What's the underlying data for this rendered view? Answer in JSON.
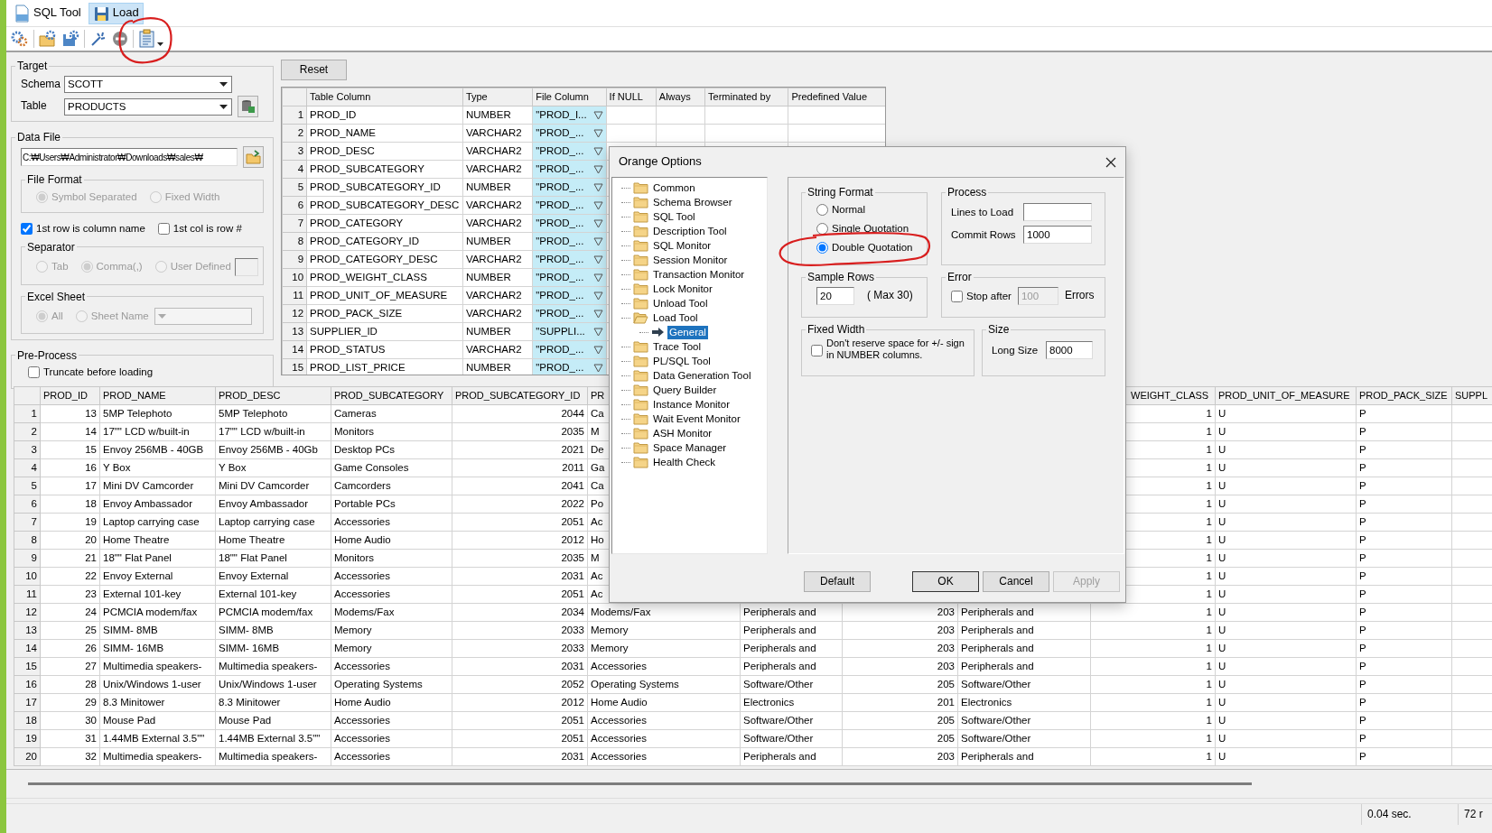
{
  "tabs": [
    {
      "label": "SQL Tool",
      "selected": false
    },
    {
      "label": "Load",
      "selected": true
    }
  ],
  "target": {
    "title": "Target",
    "schema_label": "Schema",
    "schema": "SCOTT",
    "table_label": "Table",
    "table": "PRODUCTS"
  },
  "data_file": {
    "title": "Data File",
    "path": "C:₩Users₩Administrator₩Downloads₩sales₩",
    "file_format": {
      "title": "File Format",
      "disabled": true,
      "options": [
        {
          "label": "Symbol Separated",
          "selected": true
        },
        {
          "label": "Fixed Width",
          "selected": false
        }
      ]
    },
    "checks": [
      {
        "label": "1st row is column name",
        "checked": true
      },
      {
        "label": "1st col is row #",
        "checked": false
      }
    ],
    "separator": {
      "title": "Separator",
      "disabled": true,
      "options": [
        {
          "label": "Tab",
          "selected": false
        },
        {
          "label": "Comma(,)",
          "selected": true
        },
        {
          "label": "User Defined",
          "selected": false
        }
      ]
    },
    "excel_sheet": {
      "title": "Excel Sheet",
      "disabled": true,
      "options": [
        {
          "label": "All",
          "selected": true
        },
        {
          "label": "Sheet Name",
          "selected": false
        }
      ]
    }
  },
  "pre_process": {
    "title": "Pre-Process",
    "checks": [
      {
        "label": "Truncate before loading",
        "checked": false
      }
    ]
  },
  "reset_button": "Reset",
  "mapping": {
    "columns": [
      "Table Column",
      "Type",
      "File Column",
      "If NULL",
      "Always",
      "Terminated by",
      "Predefined Value"
    ],
    "rows": [
      {
        "n": "1",
        "table_column": "PROD_ID",
        "type": "NUMBER",
        "file_column": "\"PROD_I..."
      },
      {
        "n": "2",
        "table_column": "PROD_NAME",
        "type": "VARCHAR2",
        "file_column": "\"PROD_..."
      },
      {
        "n": "3",
        "table_column": "PROD_DESC",
        "type": "VARCHAR2",
        "file_column": "\"PROD_..."
      },
      {
        "n": "4",
        "table_column": "PROD_SUBCATEGORY",
        "type": "VARCHAR2",
        "file_column": "\"PROD_..."
      },
      {
        "n": "5",
        "table_column": "PROD_SUBCATEGORY_ID",
        "type": "NUMBER",
        "file_column": "\"PROD_..."
      },
      {
        "n": "6",
        "table_column": "PROD_SUBCATEGORY_DESC",
        "type": "VARCHAR2",
        "file_column": "\"PROD_..."
      },
      {
        "n": "7",
        "table_column": "PROD_CATEGORY",
        "type": "VARCHAR2",
        "file_column": "\"PROD_..."
      },
      {
        "n": "8",
        "table_column": "PROD_CATEGORY_ID",
        "type": "NUMBER",
        "file_column": "\"PROD_..."
      },
      {
        "n": "9",
        "table_column": "PROD_CATEGORY_DESC",
        "type": "VARCHAR2",
        "file_column": "\"PROD_..."
      },
      {
        "n": "10",
        "table_column": "PROD_WEIGHT_CLASS",
        "type": "NUMBER",
        "file_column": "\"PROD_..."
      },
      {
        "n": "11",
        "table_column": "PROD_UNIT_OF_MEASURE",
        "type": "VARCHAR2",
        "file_column": "\"PROD_..."
      },
      {
        "n": "12",
        "table_column": "PROD_PACK_SIZE",
        "type": "VARCHAR2",
        "file_column": "\"PROD_..."
      },
      {
        "n": "13",
        "table_column": "SUPPLIER_ID",
        "type": "NUMBER",
        "file_column": "\"SUPPLI..."
      },
      {
        "n": "14",
        "table_column": "PROD_STATUS",
        "type": "VARCHAR2",
        "file_column": "\"PROD_..."
      },
      {
        "n": "15",
        "table_column": "PROD_LIST_PRICE",
        "type": "NUMBER",
        "file_column": "\"PROD_..."
      }
    ]
  },
  "grid": {
    "columns": [
      "PROD_ID",
      "PROD_NAME",
      "PROD_DESC",
      "PROD_SUBCATEGORY",
      "PROD_SUBCATEGORY_ID",
      "PR",
      null,
      null,
      null,
      "WEIGHT_CLASS",
      "PROD_UNIT_OF_MEASURE",
      "PROD_PACK_SIZE",
      "SUPPL"
    ],
    "rows": [
      {
        "n": "1",
        "cells": [
          "13",
          "5MP Telephoto",
          "5MP Telephoto",
          "Cameras",
          "2044",
          "Ca",
          null,
          null,
          null,
          "1",
          "U",
          "P"
        ]
      },
      {
        "n": "2",
        "cells": [
          "14",
          "17\"\" LCD w/built-in",
          "17\"\" LCD w/built-in",
          "Monitors",
          "2035",
          "M",
          null,
          null,
          null,
          "1",
          "U",
          "P"
        ]
      },
      {
        "n": "3",
        "cells": [
          "15",
          "Envoy 256MB - 40GB",
          "Envoy 256MB - 40Gb",
          "Desktop PCs",
          "2021",
          "De",
          null,
          null,
          null,
          "1",
          "U",
          "P"
        ]
      },
      {
        "n": "4",
        "cells": [
          "16",
          "Y Box",
          "Y Box",
          "Game Consoles",
          "2011",
          "Ga",
          null,
          null,
          null,
          "1",
          "U",
          "P"
        ]
      },
      {
        "n": "5",
        "cells": [
          "17",
          "Mini DV Camcorder",
          "Mini DV Camcorder",
          "Camcorders",
          "2041",
          "Ca",
          null,
          null,
          null,
          "1",
          "U",
          "P"
        ]
      },
      {
        "n": "6",
        "cells": [
          "18",
          "Envoy Ambassador",
          "Envoy Ambassador",
          "Portable PCs",
          "2022",
          "Po",
          null,
          null,
          null,
          "1",
          "U",
          "P"
        ]
      },
      {
        "n": "7",
        "cells": [
          "19",
          "Laptop carrying case",
          "Laptop carrying case",
          "Accessories",
          "2051",
          "Ac",
          null,
          null,
          null,
          "1",
          "U",
          "P"
        ]
      },
      {
        "n": "8",
        "cells": [
          "20",
          "Home Theatre",
          "Home Theatre",
          "Home Audio",
          "2012",
          "Ho",
          null,
          null,
          null,
          "1",
          "U",
          "P"
        ]
      },
      {
        "n": "9",
        "cells": [
          "21",
          "18\"\" Flat Panel",
          "18\"\" Flat Panel",
          "Monitors",
          "2035",
          "M",
          null,
          null,
          null,
          "1",
          "U",
          "P"
        ]
      },
      {
        "n": "10",
        "cells": [
          "22",
          "Envoy External",
          "Envoy External",
          "Accessories",
          "2031",
          "Ac",
          null,
          null,
          null,
          "1",
          "U",
          "P"
        ]
      },
      {
        "n": "11",
        "cells": [
          "23",
          "External 101-key",
          "External 101-key",
          "Accessories",
          "2051",
          "Ac",
          null,
          null,
          null,
          "1",
          "U",
          "P"
        ]
      },
      {
        "n": "12",
        "cells": [
          "24",
          "PCMCIA modem/fax",
          "PCMCIA modem/fax",
          "Modems/Fax",
          "2034",
          "Modems/Fax",
          "Peripherals and",
          "203",
          "Peripherals and",
          "1",
          "U",
          "P"
        ]
      },
      {
        "n": "13",
        "cells": [
          "25",
          "SIMM- 8MB",
          "SIMM- 8MB",
          "Memory",
          "2033",
          "Memory",
          "Peripherals and",
          "203",
          "Peripherals and",
          "1",
          "U",
          "P"
        ]
      },
      {
        "n": "14",
        "cells": [
          "26",
          "SIMM- 16MB",
          "SIMM- 16MB",
          "Memory",
          "2033",
          "Memory",
          "Peripherals and",
          "203",
          "Peripherals and",
          "1",
          "U",
          "P"
        ]
      },
      {
        "n": "15",
        "cells": [
          "27",
          "Multimedia speakers-",
          "Multimedia speakers-",
          "Accessories",
          "2031",
          "Accessories",
          "Peripherals and",
          "203",
          "Peripherals and",
          "1",
          "U",
          "P"
        ]
      },
      {
        "n": "16",
        "cells": [
          "28",
          "Unix/Windows 1-user",
          "Unix/Windows 1-user",
          "Operating Systems",
          "2052",
          "Operating Systems",
          "Software/Other",
          "205",
          "Software/Other",
          "1",
          "U",
          "P"
        ]
      },
      {
        "n": "17",
        "cells": [
          "29",
          "8.3 Minitower",
          "8.3 Minitower",
          "Home Audio",
          "2012",
          "Home Audio",
          "Electronics",
          "201",
          "Electronics",
          "1",
          "U",
          "P"
        ]
      },
      {
        "n": "18",
        "cells": [
          "30",
          "Mouse Pad",
          "Mouse Pad",
          "Accessories",
          "2051",
          "Accessories",
          "Software/Other",
          "205",
          "Software/Other",
          "1",
          "U",
          "P"
        ]
      },
      {
        "n": "19",
        "cells": [
          "31",
          "1.44MB External 3.5\"\"",
          "1.44MB External 3.5\"\"",
          "Accessories",
          "2051",
          "Accessories",
          "Software/Other",
          "205",
          "Software/Other",
          "1",
          "U",
          "P"
        ]
      },
      {
        "n": "20",
        "cells": [
          "32",
          "Multimedia speakers-",
          "Multimedia speakers-",
          "Accessories",
          "2031",
          "Accessories",
          "Peripherals and",
          "203",
          "Peripherals and",
          "1",
          "U",
          "P"
        ]
      }
    ]
  },
  "status_bar": {
    "elapsed": "0.04 sec.",
    "rows": "72 r"
  },
  "options_dialog": {
    "title": "Orange Options",
    "tree": [
      {
        "label": "Common",
        "expanded": false,
        "selected": false
      },
      {
        "label": "Schema Browser",
        "expanded": false,
        "selected": false
      },
      {
        "label": "SQL Tool",
        "expanded": false,
        "selected": false
      },
      {
        "label": "Description Tool",
        "expanded": false,
        "selected": false
      },
      {
        "label": "SQL Monitor",
        "expanded": false,
        "selected": false
      },
      {
        "label": "Session Monitor",
        "expanded": false,
        "selected": false
      },
      {
        "label": "Transaction Monitor",
        "expanded": false,
        "selected": false
      },
      {
        "label": "Lock Monitor",
        "expanded": false,
        "selected": false
      },
      {
        "label": "Unload Tool",
        "expanded": false,
        "selected": false
      },
      {
        "label": "Load Tool",
        "expanded": true,
        "selected": false,
        "children": [
          {
            "label": "General",
            "selected": true
          }
        ]
      },
      {
        "label": "Trace Tool",
        "expanded": false,
        "selected": false
      },
      {
        "label": "PL/SQL Tool",
        "expanded": false,
        "selected": false
      },
      {
        "label": "Data Generation Tool",
        "expanded": false,
        "selected": false
      },
      {
        "label": "Query Builder",
        "expanded": false,
        "selected": false
      },
      {
        "label": "Instance Monitor",
        "expanded": false,
        "selected": false
      },
      {
        "label": "Wait Event Monitor",
        "expanded": false,
        "selected": false
      },
      {
        "label": "ASH Monitor",
        "expanded": false,
        "selected": false
      },
      {
        "label": "Space Manager",
        "expanded": false,
        "selected": false
      },
      {
        "label": "Health Check",
        "expanded": false,
        "selected": false
      }
    ],
    "string_format": {
      "title": "String Format",
      "options": [
        {
          "label": "Normal",
          "selected": false
        },
        {
          "label": "Single Quotation",
          "selected": false
        },
        {
          "label": "Double Quotation",
          "selected": true
        }
      ]
    },
    "process": {
      "title": "Process",
      "lines_label": "Lines to Load",
      "commit_label": "Commit Rows",
      "commit_rows": "1000"
    },
    "sample_rows": {
      "title": "Sample Rows",
      "value": "20",
      "note": "( Max 30)"
    },
    "error": {
      "title": "Error",
      "label": "Stop after",
      "checked": false,
      "value": "100",
      "value_disabled": true,
      "unit": "Errors"
    },
    "fixed_width": {
      "title": "Fixed Width",
      "label": "Don't reserve space for  +/- sign in NUMBER columns.",
      "checked": false
    },
    "size": {
      "title": "Size",
      "label": "Long Size",
      "value": "8000"
    },
    "buttons": [
      {
        "label": "Default",
        "disabled": false
      },
      {
        "label": "OK",
        "disabled": false
      },
      {
        "label": "Cancel",
        "disabled": false
      },
      {
        "label": "Apply",
        "disabled": true
      }
    ]
  }
}
